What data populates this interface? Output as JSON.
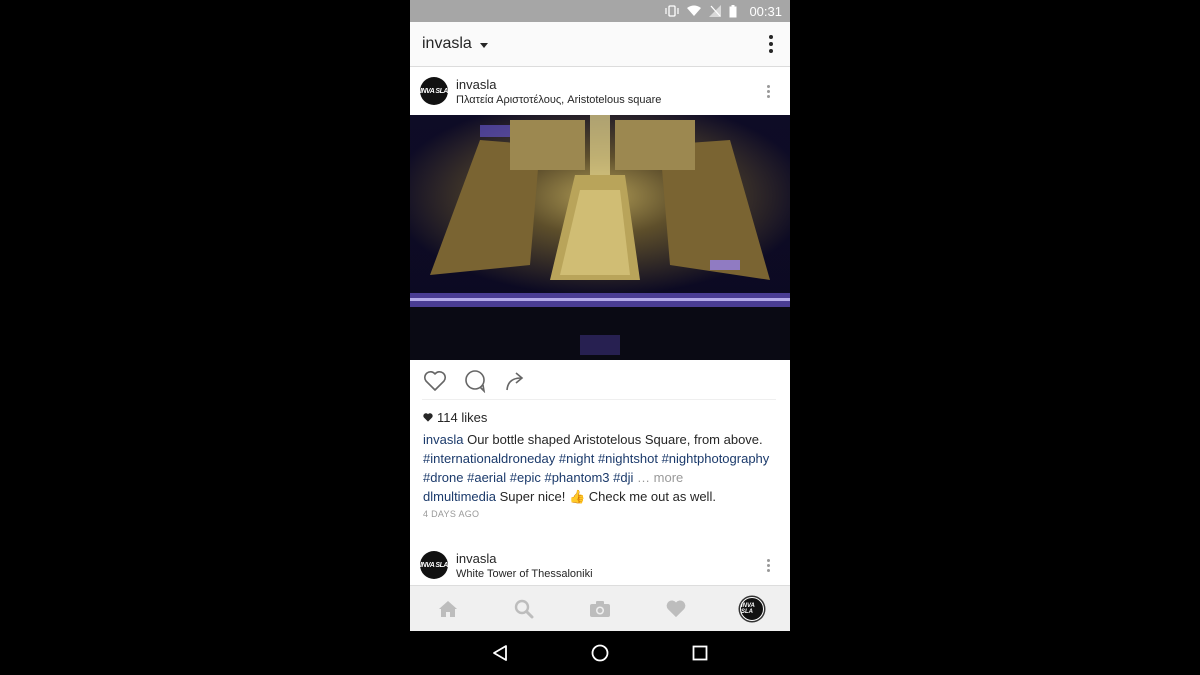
{
  "status_bar": {
    "time": "00:31"
  },
  "app_bar": {
    "account": "invasla"
  },
  "post": {
    "avatar_text": "INVA SLA",
    "username": "invasla",
    "location": "Πλατεία Αριστοτέλους, Aristotelous square",
    "likes": "114 likes",
    "caption": {
      "user": "invasla",
      "text": "Our bottle shaped Aristotelous Square, from above.",
      "tags": [
        "#internationaldroneday",
        "#night",
        "#nightshot",
        "#nightphotography",
        "#drone",
        "#aerial",
        "#epic",
        "#phantom3",
        "#dji"
      ],
      "more": "… more"
    },
    "comment": {
      "user": "dlmultimedia",
      "text": "Super nice! 👍 Check me out as well."
    },
    "time_ago": "4 DAYS AGO"
  },
  "next_post": {
    "avatar_text": "INVA SLA",
    "username": "invasla",
    "location": "White Tower of Thessaloniki"
  },
  "tab_bar": [
    "home-icon",
    "search-icon",
    "camera-icon",
    "heart-icon",
    "profile-avatar"
  ],
  "nav_bar": [
    "back-icon",
    "home-circle-icon",
    "recents-icon"
  ]
}
